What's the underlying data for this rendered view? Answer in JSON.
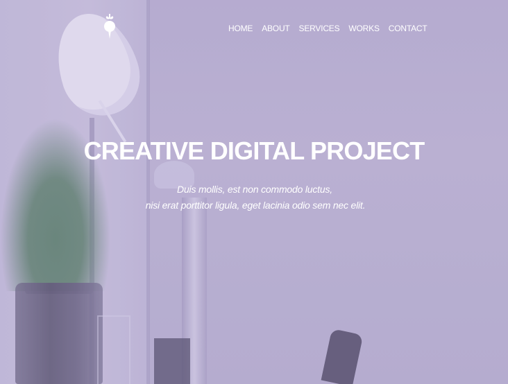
{
  "header": {
    "logo_icon": "radish-icon",
    "nav": [
      {
        "label": "HOME"
      },
      {
        "label": "ABOUT"
      },
      {
        "label": "SERVICES"
      },
      {
        "label": "WORKS"
      },
      {
        "label": "CONTACT"
      }
    ]
  },
  "hero": {
    "title": "CREATIVE DIGITAL PROJECT",
    "subtitle_line1": "Duis mollis, est non commodo luctus,",
    "subtitle_line2": "nisi erat porttitor ligula, eget lacinia odio sem nec elit."
  },
  "colors": {
    "overlay": "#b7aed0",
    "text": "#ffffff"
  }
}
